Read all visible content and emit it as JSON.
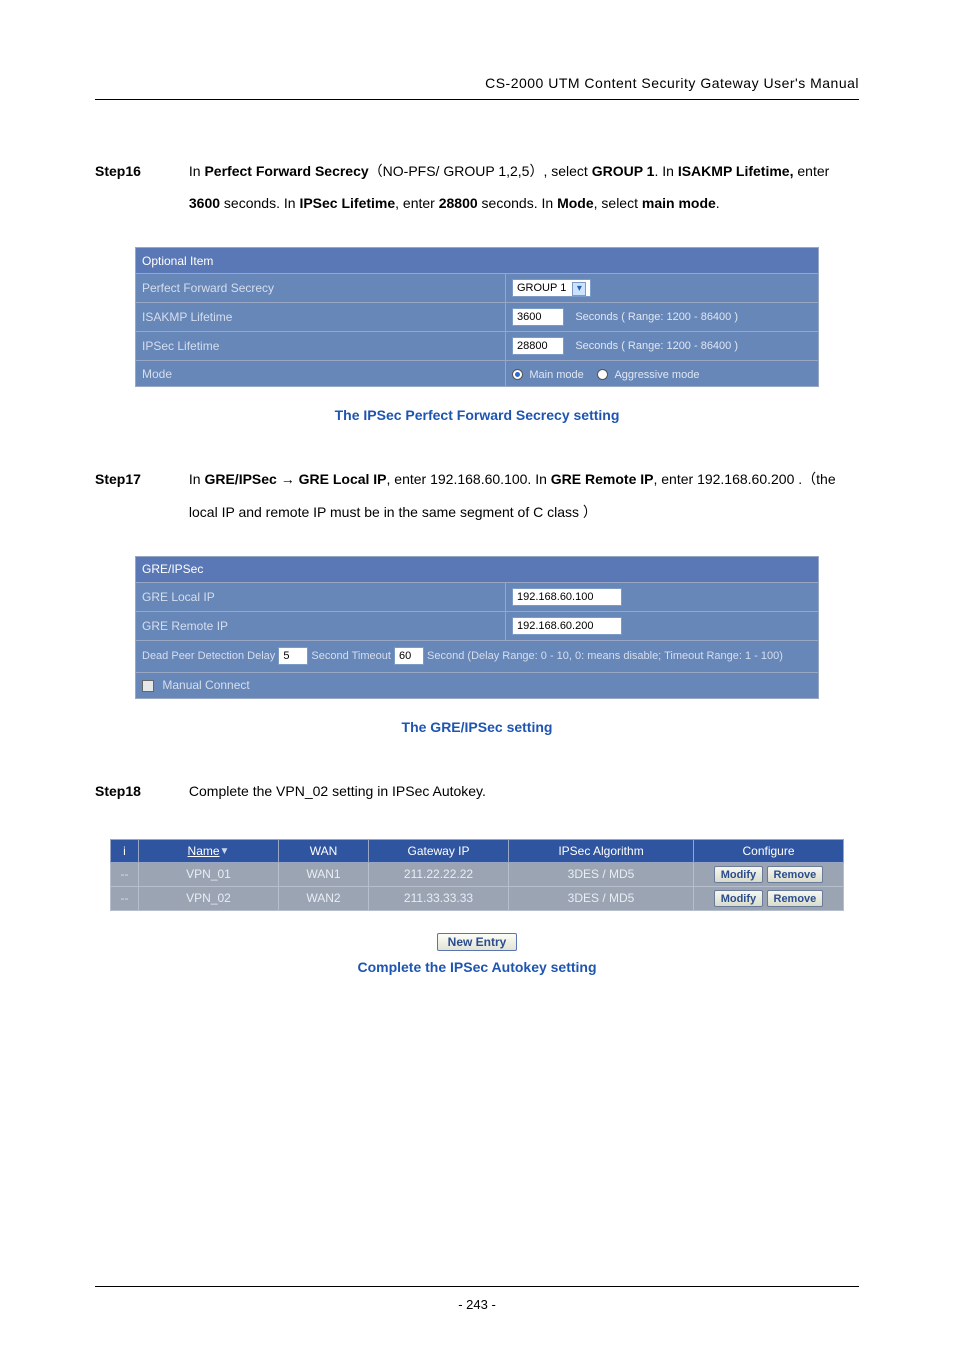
{
  "header": "CS-2000 UTM Content Security Gateway User's Manual",
  "step16": {
    "label": "Step16",
    "run": [
      {
        "t": "In "
      },
      {
        "t": "Perfect Forward Secrecy",
        "b": true
      },
      {
        "t": "（NO-PFS/ GROUP 1,2,5）, select "
      },
      {
        "t": "GROUP 1",
        "b": true
      },
      {
        "t": ". In "
      },
      {
        "t": "ISAKMP Lifetime,",
        "b": true
      },
      {
        "t": " enter "
      },
      {
        "t": "3600",
        "b": true
      },
      {
        "t": " seconds. In "
      },
      {
        "t": "IPSec Lifetime",
        "b": true
      },
      {
        "t": ", enter "
      },
      {
        "t": "28800",
        "b": true
      },
      {
        "t": " seconds. In "
      },
      {
        "t": "Mode",
        "b": true
      },
      {
        "t": ", select "
      },
      {
        "t": "main mode",
        "b": true
      },
      {
        "t": "."
      }
    ]
  },
  "fig1": {
    "title": "Optional Item",
    "rows": {
      "pfs_label": "Perfect Forward Secrecy",
      "pfs_value": "GROUP 1",
      "isakmp_label": "ISAKMP Lifetime",
      "isakmp_value": "3600",
      "isakmp_range": "Seconds  ( Range: 1200 - 86400 )",
      "ipsec_label": "IPSec Lifetime",
      "ipsec_value": "28800",
      "ipsec_range": "Seconds  ( Range: 1200 - 86400 )",
      "mode_label": "Mode",
      "main": "Main mode",
      "aggr": "Aggressive mode"
    },
    "caption": "The IPSec Perfect Forward Secrecy setting"
  },
  "step17": {
    "label": "Step17",
    "run": [
      {
        "t": "In "
      },
      {
        "t": "GRE/IPSec → GRE Local IP",
        "b": true
      },
      {
        "t": ", enter 192.168.60.100. In "
      },
      {
        "t": "GRE Remote IP",
        "b": true
      },
      {
        "t": ", enter 192.168.60.200 .（the local IP and remote IP must be in the same segment of C class ）"
      }
    ]
  },
  "fig2": {
    "title": "GRE/IPSec",
    "local_label": "GRE Local IP",
    "local_value": "192.168.60.100",
    "remote_label": "GRE Remote IP",
    "remote_value": "192.168.60.200",
    "dpd_prefix": "Dead Peer Detection   Delay",
    "dpd_delay": "5",
    "dpd_mid": "Second     Timeout",
    "dpd_timeout": "60",
    "dpd_suffix": "Second (Delay Range: 0 - 10, 0: means disable; Timeout Range: 1 - 100)",
    "manual": "Manual Connect",
    "caption": "The GRE/IPSec setting"
  },
  "step18": {
    "label": "Step18",
    "text": "Complete the VPN_02 setting in IPSec Autokey."
  },
  "fig3": {
    "headers": {
      "i": "i",
      "name": "Name",
      "wan": "WAN",
      "gw": "Gateway IP",
      "alg": "IPSec Algorithm",
      "conf": "Configure"
    },
    "rows": [
      {
        "i": "--",
        "name": "VPN_01",
        "wan": "WAN1",
        "gw": "211.22.22.22",
        "alg": "3DES / MD5"
      },
      {
        "i": "--",
        "name": "VPN_02",
        "wan": "WAN2",
        "gw": "211.33.33.33",
        "alg": "3DES / MD5"
      }
    ],
    "modify": "Modify",
    "remove": "Remove",
    "newentry": "New Entry",
    "caption": "Complete the IPSec Autokey setting"
  },
  "footer": "- 243 -"
}
